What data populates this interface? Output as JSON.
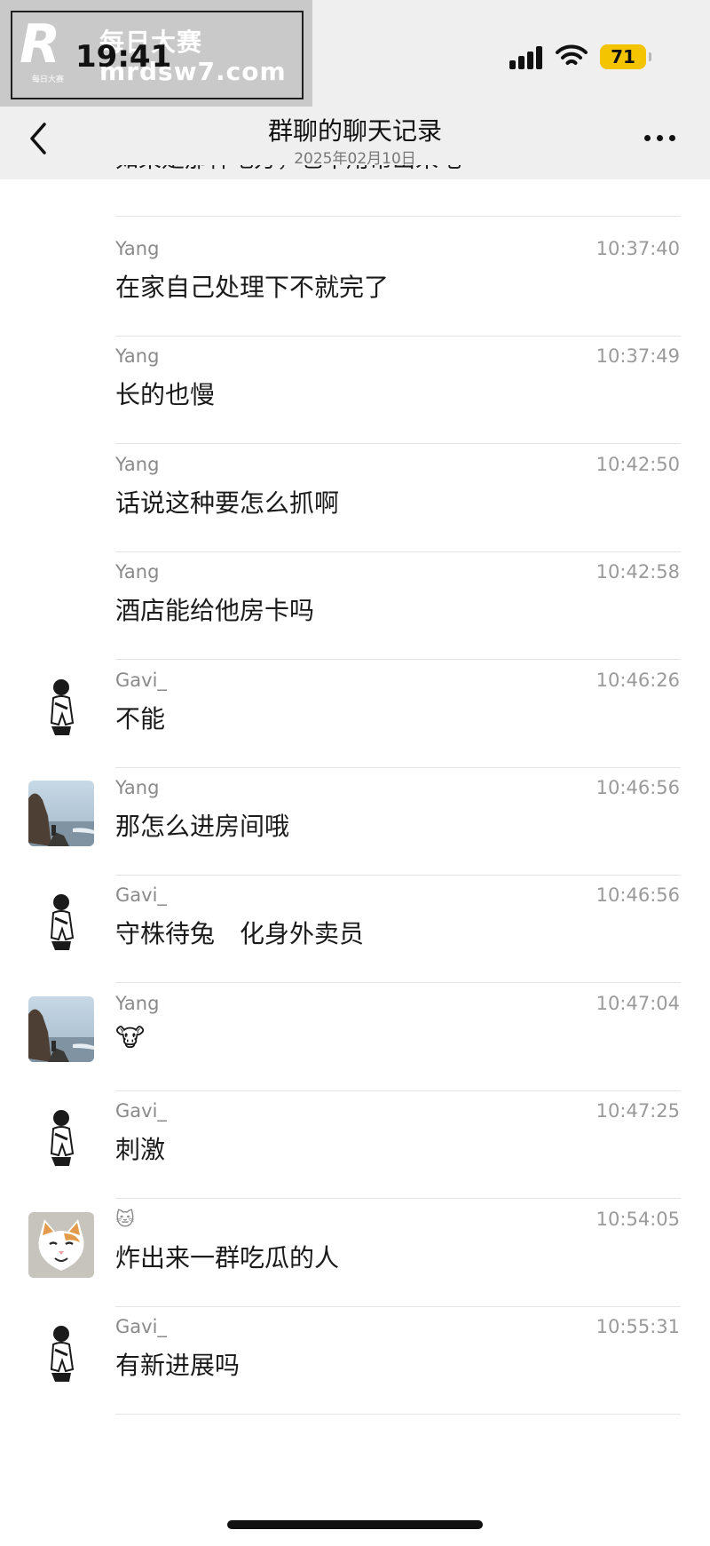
{
  "watermark": {
    "logo": "R",
    "small_text": "每日大赛",
    "site_cn": "每日大赛",
    "site": "mrdsw7.com"
  },
  "status_bar": {
    "time": "19:41",
    "battery": "71"
  },
  "header": {
    "title": "群聊的聊天记录",
    "date": "2025年02月10日"
  },
  "partial_message": "如果是那种地方，也不用帮出来吧",
  "messages": [
    {
      "sender": "Yang",
      "time": "10:37:40",
      "text": "在家自己处理下不就完了",
      "avatar": "none"
    },
    {
      "sender": "Yang",
      "time": "10:37:49",
      "text": "长的也慢",
      "avatar": "none"
    },
    {
      "sender": "Yang",
      "time": "10:42:50",
      "text": "话说这种要怎么抓啊",
      "avatar": "none"
    },
    {
      "sender": "Yang",
      "time": "10:42:58",
      "text": "酒店能给他房卡吗",
      "avatar": "none"
    },
    {
      "sender": "Gavi_",
      "time": "10:46:26",
      "text": "不能",
      "avatar": "person-sketch"
    },
    {
      "sender": "Yang",
      "time": "10:46:56",
      "text": "那怎么进房间哦",
      "avatar": "sea-rock-photo"
    },
    {
      "sender": "Gavi_",
      "time": "10:46:56",
      "text": "守株待兔　化身外卖员",
      "avatar": "person-sketch"
    },
    {
      "sender": "Yang",
      "time": "10:47:04",
      "text": "🐮",
      "avatar": "sea-rock-photo"
    },
    {
      "sender": "Gavi_",
      "time": "10:47:25",
      "text": "刺激",
      "avatar": "person-sketch"
    },
    {
      "sender": "🐱",
      "time": "10:54:05",
      "text": "炸出来一群吃瓜的人",
      "avatar": "cat-photo"
    },
    {
      "sender": "Gavi_",
      "time": "10:55:31",
      "text": "有新进展吗",
      "avatar": "person-sketch"
    }
  ],
  "colors": {
    "header_bg": "#efefef",
    "battery": "#f5c400",
    "divider": "#e4e4e4"
  }
}
